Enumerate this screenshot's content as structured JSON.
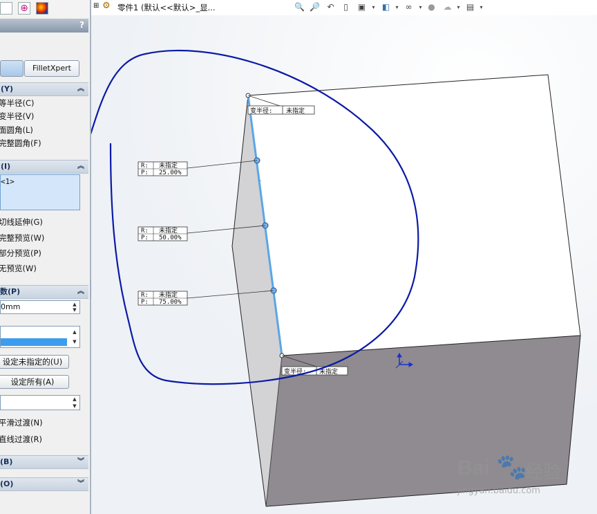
{
  "document_title": "零件1  (默认<<默认>_显...",
  "panel": {
    "help": "?",
    "tabs": [
      "",
      "FilletXpert"
    ],
    "sections": {
      "fillet_type": {
        "header": "(Y)",
        "options": [
          "等半径(C)",
          "变半径(V)",
          "面圆角(L)",
          "完整圆角(F)"
        ]
      },
      "items": {
        "header": "(I)",
        "selection": "<1>",
        "options": [
          "切线延伸(G)",
          "完整预览(W)",
          "部分预览(P)",
          "无预览(W)"
        ]
      },
      "params": {
        "header": "数(P)",
        "radius_value": "0mm",
        "set_unassigned_button": "设定未指定的(U)",
        "set_all_button": "设定所有(A)",
        "transition_options": [
          "平滑过渡(N)",
          "直线过渡(R)"
        ]
      },
      "setback": {
        "header": "(B)"
      },
      "options": {
        "header": "(O)"
      }
    }
  },
  "callouts": {
    "var_radius_label": "变半径:",
    "unassigned": "未指定",
    "r_label": "R:",
    "p_label": "P:",
    "percents": [
      "25.00%",
      "50.00%",
      "75.00%"
    ]
  },
  "watermark": {
    "brand": "Bai",
    "brand2": "经验",
    "url": "jingyan.baidu.com"
  },
  "colors": {
    "edge_highlight": "#5aa6e6",
    "annotation_stroke": "#0a1aa6",
    "cube_top": "#ffffff",
    "cube_left": "#d3d2d4",
    "cube_front": "#8f8b90"
  }
}
